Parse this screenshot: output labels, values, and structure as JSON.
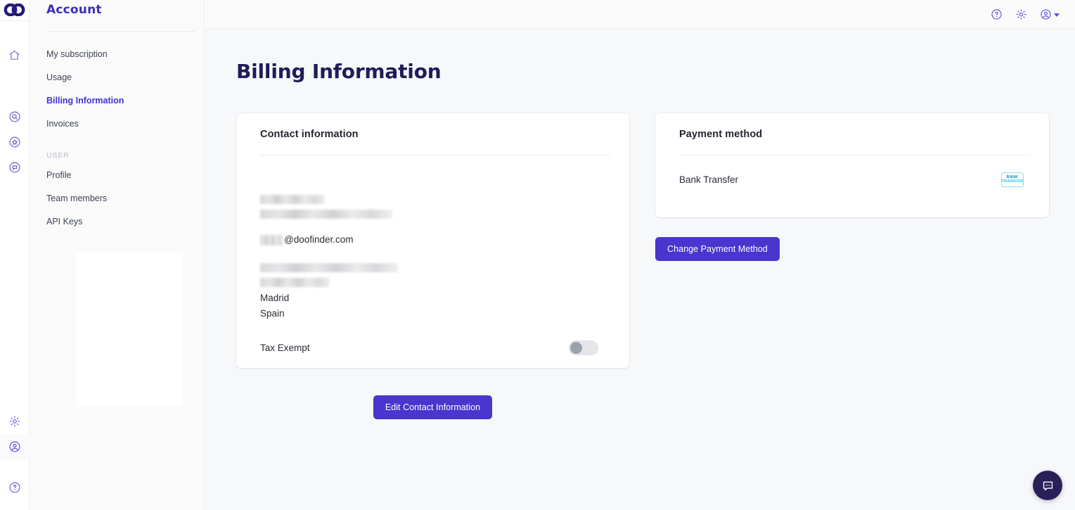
{
  "brand": {
    "logo_name": "doofinder-logo",
    "primary": "#4a35cf",
    "title_color": "#211b58",
    "accent": "#4130d4"
  },
  "rail": {
    "items": [
      {
        "icon": "home-icon",
        "name": "rail-item-home"
      },
      {
        "icon": "search-target-icon",
        "name": "rail-item-search"
      },
      {
        "icon": "star-badge-icon",
        "name": "rail-item-favorites"
      },
      {
        "icon": "chat-bubble-circle-icon",
        "name": "rail-item-messages"
      }
    ],
    "bottom_items": [
      {
        "icon": "gear-icon",
        "name": "rail-item-settings"
      },
      {
        "icon": "user-circle-icon",
        "name": "rail-item-account"
      },
      {
        "icon": "help-circle-icon",
        "name": "rail-item-help"
      }
    ]
  },
  "sidebar": {
    "title": "Account",
    "items": [
      {
        "label": "My subscription",
        "active": false
      },
      {
        "label": "Usage",
        "active": false
      },
      {
        "label": "Billing Information",
        "active": true
      },
      {
        "label": "Invoices",
        "active": false
      }
    ],
    "section_label": "USER",
    "user_items": [
      {
        "label": "Profile",
        "active": false
      },
      {
        "label": "Team members",
        "active": false
      },
      {
        "label": "API Keys",
        "active": false
      }
    ]
  },
  "topbar": {
    "help_icon": "help-circle-icon",
    "settings_icon": "gear-icon",
    "account_icon": "user-circle-icon",
    "caret_icon": "chevron-down-icon"
  },
  "page": {
    "title": "Billing Information"
  },
  "contact_card": {
    "title": "Contact information",
    "name_redacted_1": "",
    "name_redacted_2": "",
    "email_redacted": "",
    "email_domain": "@doofinder.com",
    "address_redacted_1": "",
    "address_redacted_2": "",
    "city": "Madrid",
    "country": "Spain",
    "tax_exempt_label": "Tax Exempt",
    "tax_exempt_on": false
  },
  "payment_card": {
    "title": "Payment method",
    "method_label": "Bank Transfer",
    "badge_line1": "BANK",
    "badge_line2": "TRANSFER"
  },
  "actions": {
    "change_payment": "Change Payment Method",
    "edit_contact": "Edit Contact Information"
  },
  "chat": {
    "icon": "chat-bubble-icon"
  }
}
